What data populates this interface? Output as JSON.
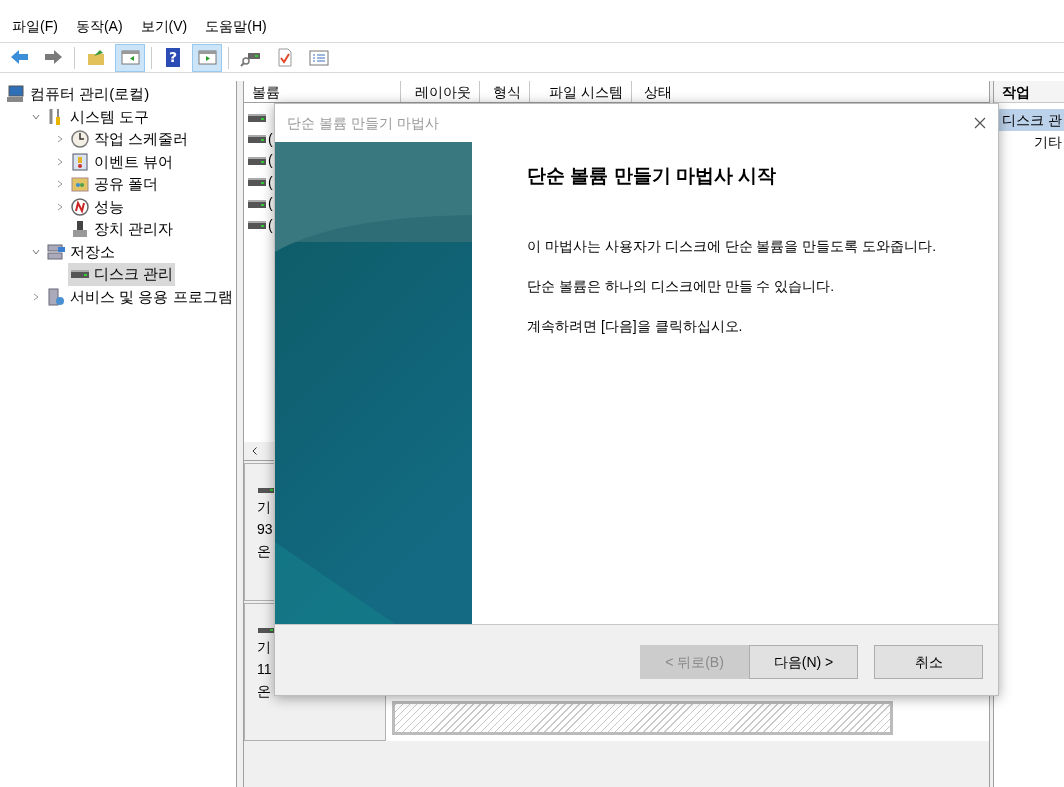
{
  "menu_bar": [
    "파일(F)",
    "동작(A)",
    "보기(V)",
    "도움말(H)"
  ],
  "toolbar": [
    {
      "kind": "back",
      "pressed": false
    },
    {
      "kind": "forward",
      "pressed": false
    },
    {
      "kind": "separator"
    },
    {
      "kind": "up",
      "pressed": false
    },
    {
      "kind": "tree-toggle",
      "pressed": true
    },
    {
      "kind": "separator"
    },
    {
      "kind": "help",
      "glyph": "?",
      "pressed": false
    },
    {
      "kind": "action-toggle",
      "pressed": true
    },
    {
      "kind": "separator"
    },
    {
      "kind": "connect",
      "pressed": false
    },
    {
      "kind": "check",
      "pressed": false
    },
    {
      "kind": "list",
      "pressed": false
    }
  ],
  "tree": [
    {
      "label": "컴퓨터 관리(로컬)",
      "kind": "computer",
      "selected": false,
      "children": [
        {
          "label": "시스템 도구",
          "kind": "tools",
          "expanded": true,
          "selected": false,
          "children": [
            {
              "label": "작업 스케줄러",
              "kind": "clock",
              "expanded": false,
              "selected": false
            },
            {
              "label": "이벤트 뷰어",
              "kind": "viewer",
              "expanded": false,
              "selected": false
            },
            {
              "label": "공유 폴더",
              "kind": "folder",
              "expanded": false,
              "selected": false
            },
            {
              "label": "성능",
              "kind": "gauge",
              "expanded": false,
              "selected": false
            },
            {
              "label": "장치 관리자",
              "kind": "device",
              "selected": false
            }
          ]
        },
        {
          "label": "저장소",
          "kind": "storage",
          "expanded": true,
          "selected": false,
          "children": [
            {
              "label": "디스크 관리",
              "kind": "drive",
              "selected": true
            }
          ]
        },
        {
          "label": "서비스 및 응용 프로그램",
          "kind": "services",
          "expanded": false,
          "selected": false
        }
      ]
    }
  ],
  "volume_list": {
    "columns": [
      "볼륨",
      "레이아웃",
      "형식",
      "파일 시스템",
      "상태"
    ],
    "rows": [
      {
        "kind": "drive"
      },
      {
        "kind": "drive",
        "volume": "("
      },
      {
        "kind": "drive",
        "volume": "("
      },
      {
        "kind": "drive",
        "volume": "("
      },
      {
        "kind": "drive",
        "volume": "("
      },
      {
        "kind": "drive",
        "volume": "("
      }
    ]
  },
  "disks": [
    {
      "lines": [
        "기",
        "93",
        "온"
      ]
    },
    {
      "lines": [
        "기",
        "11",
        "온"
      ]
    }
  ],
  "action_pane": {
    "title": "작업",
    "items": [
      {
        "label": "디스크 관",
        "selected": true,
        "children": [
          {
            "label": "기타",
            "selected": false
          }
        ]
      }
    ]
  },
  "dialog": {
    "title": "단순 볼륨 만들기 마법사",
    "heading": "단순 볼륨 만들기 마법사 시작",
    "paragraphs": [
      "이 마법사는 사용자가 디스크에 단순 볼륨을 만들도록 도와줍니다.",
      "단순 볼륨은 하나의 디스크에만 만들 수 있습니다.",
      "계속하려면 [다음]을 클릭하십시오."
    ],
    "buttons": [
      {
        "label": "< 뒤로(B)",
        "disabled": true
      },
      {
        "label": "다음(N) >",
        "disabled": false
      },
      {
        "label": "취소",
        "disabled": false
      }
    ]
  }
}
